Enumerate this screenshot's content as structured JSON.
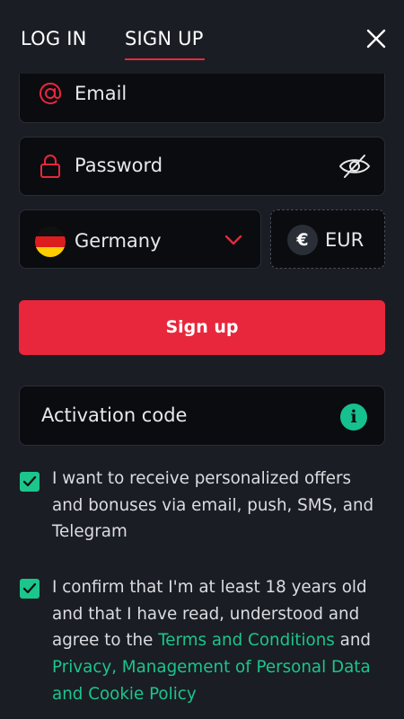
{
  "header": {
    "tab_login": "LOG IN",
    "tab_signup": "SIGN UP",
    "close_icon": "close-icon"
  },
  "form": {
    "email_placeholder": "Email",
    "password_placeholder": "Password",
    "country": "Germany",
    "currency": "EUR",
    "currency_symbol": "€",
    "signup_label": "Sign up",
    "activation_placeholder": "Activation code",
    "info_symbol": "i"
  },
  "consents": {
    "offers": {
      "checked": true,
      "text": "I want to receive personalized offers and bonuses via email, push, SMS, and Telegram"
    },
    "age": {
      "checked": true,
      "text_before": "I confirm that I'm at least 18 years old and that I have read, understood and agree to the ",
      "link_terms": "Terms and Conditions",
      "text_and": " and ",
      "link_privacy": "Privacy, Management of Personal Data and Cookie Policy"
    }
  },
  "colors": {
    "accent_red": "#e8273c",
    "accent_green": "#1bc58c",
    "background": "#1a1d24",
    "field_background": "#0b0c10"
  }
}
